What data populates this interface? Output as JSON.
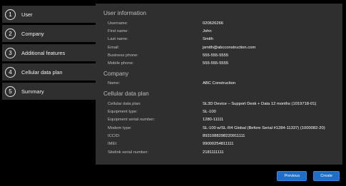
{
  "steps": [
    {
      "num": "1",
      "label": "User"
    },
    {
      "num": "2",
      "label": "Company"
    },
    {
      "num": "3",
      "label": "Additional features"
    },
    {
      "num": "4",
      "label": "Cellular data plan"
    },
    {
      "num": "5",
      "label": "Summary"
    }
  ],
  "user": {
    "title": "User information",
    "rows": [
      {
        "label": "Username:",
        "value": "020626266"
      },
      {
        "label": "First name:",
        "value": "John"
      },
      {
        "label": "Last name:",
        "value": "Smith"
      },
      {
        "label": "Email:",
        "value": "jsmith@abcconstruction.com"
      },
      {
        "label": "Business phone:",
        "value": "555-555-5555"
      },
      {
        "label": "Mobile phone:",
        "value": "555-555-5555"
      }
    ]
  },
  "company": {
    "title": "Company",
    "rows": [
      {
        "label": "Name:",
        "value": "ABC Construction"
      }
    ]
  },
  "plan": {
    "title": "Cellular data plan",
    "rows": [
      {
        "label": "Cellular data plan:",
        "value": "SL3D Device – Support Desk + Data 12 months (1019718-01)"
      },
      {
        "label": "Equipment type:",
        "value": "SL-100"
      },
      {
        "label": "Equipment serial number:",
        "value": "1280-11111"
      },
      {
        "label": "Modem type:",
        "value": "SL-100 w/SL-R4 Global (Before Serial #1284-11337) (1000082-20)"
      },
      {
        "label": "ICCID:",
        "value": "8931088298220911111"
      },
      {
        "label": "IMEI:",
        "value": "99000254811111"
      },
      {
        "label": "Sitelink serial number:",
        "value": "2181111111"
      }
    ]
  },
  "footer": {
    "previous_label": "Previous",
    "create_label": "Create"
  }
}
